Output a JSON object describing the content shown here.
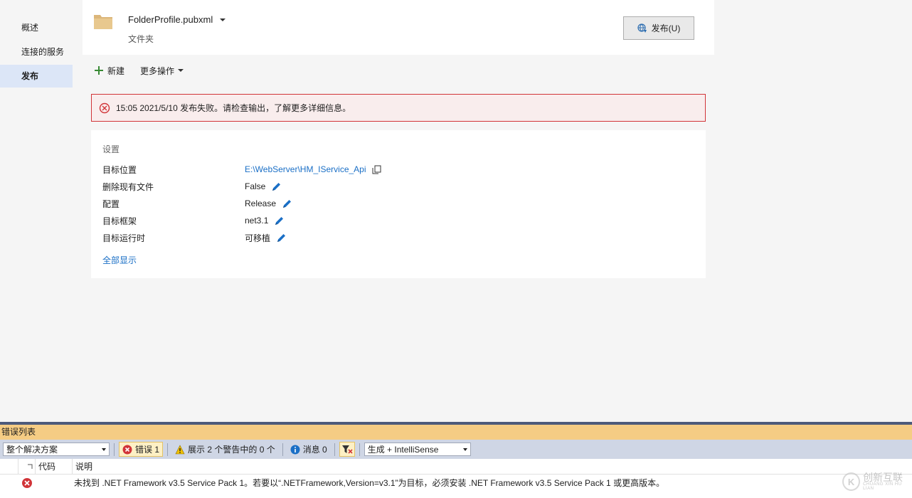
{
  "nav": {
    "items": [
      {
        "label": "概述"
      },
      {
        "label": "连接的服务"
      },
      {
        "label": "发布",
        "active": true
      }
    ]
  },
  "profile": {
    "name": "FolderProfile.pubxml",
    "type": "文件夹",
    "publish_label": "发布(U)"
  },
  "toolbar": {
    "new_label": "新建",
    "more_label": "更多操作"
  },
  "error_banner": {
    "text": "15:05 2021/5/10 发布失败。请检查输出，了解更多详细信息。"
  },
  "settings": {
    "title": "设置",
    "rows": [
      {
        "key": "目标位置",
        "value": "E:\\WebServer\\HM_IService_Api",
        "action": "copy-icon"
      },
      {
        "key": "删除现有文件",
        "value": "False",
        "action": "edit-pencil-icon"
      },
      {
        "key": "配置",
        "value": "Release",
        "action": "edit-pencil-icon"
      },
      {
        "key": "目标框架",
        "value": "net3.1",
        "action": "edit-pencil-icon"
      },
      {
        "key": "目标运行时",
        "value": "可移植",
        "action": "edit-pencil-icon"
      }
    ],
    "show_all": "全部显示"
  },
  "error_list": {
    "title": "错误列表",
    "scope": "整个解决方案",
    "errors_label": "错误 1",
    "warnings_label": "展示 2 个警告中的 0 个",
    "messages_label": "消息 0",
    "source": "生成 + IntelliSense",
    "columns": {
      "code": "代码",
      "description": "说明"
    },
    "rows": [
      {
        "description": "未找到 .NET Framework v3.5 Service Pack 1。若要以“.NETFramework,Version=v3.1”为目标，必须安装 .NET Framework v3.5 Service Pack 1 或更高版本。"
      }
    ]
  },
  "watermark": {
    "text": "创新互联",
    "sub": "CHUANG XIN HU LIAN"
  },
  "colors": {
    "accent": "#1a6fc6",
    "error": "#d13438",
    "nav_active": "#dce6f7",
    "panel_title": "#f5cc84",
    "new_icon": "#388a34"
  }
}
